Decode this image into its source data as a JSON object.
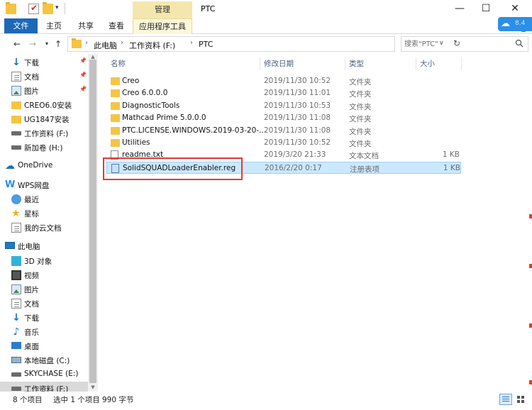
{
  "window": {
    "title": "PTC",
    "manage_tab": "管理",
    "minimize": "—",
    "maximize": "☐",
    "close": "✕"
  },
  "ribbon": {
    "tabs": [
      "文件",
      "主页",
      "共享",
      "查看",
      "应用程序工具"
    ],
    "help": "?"
  },
  "baidu": {
    "text": "8.4"
  },
  "address": {
    "crumbs": [
      "此电脑",
      "工作资料 (F:)",
      "PTC"
    ],
    "search_placeholder": "搜索\"PTC\""
  },
  "nav": {
    "items": [
      {
        "label": "下载",
        "icon": "download-icon",
        "pinned": true
      },
      {
        "label": "文档",
        "icon": "document-icon",
        "pinned": true
      },
      {
        "label": "图片",
        "icon": "picture-icon",
        "pinned": true
      },
      {
        "label": "CREO6.0安装",
        "icon": "folder-icon",
        "pinned": false
      },
      {
        "label": "UG1847安装",
        "icon": "folder-icon",
        "pinned": false
      },
      {
        "label": "工作资料 (F:)",
        "icon": "drive-icon",
        "pinned": false
      },
      {
        "label": "新加卷 (H:)",
        "icon": "drive-icon",
        "pinned": false
      },
      {
        "label": "OneDrive",
        "icon": "onedrive-icon",
        "pinned": false
      },
      {
        "label": "WPS网盘",
        "icon": "wps-icon",
        "pinned": false
      },
      {
        "label": "最近",
        "icon": "clock-icon",
        "pinned": false
      },
      {
        "label": "星标",
        "icon": "star-icon",
        "pinned": false
      },
      {
        "label": "我的云文档",
        "icon": "document-icon",
        "pinned": false
      },
      {
        "label": "此电脑",
        "icon": "computer-icon",
        "pinned": false
      },
      {
        "label": "3D 对象",
        "icon": "cube-icon",
        "pinned": false
      },
      {
        "label": "视频",
        "icon": "video-icon",
        "pinned": false
      },
      {
        "label": "图片",
        "icon": "picture-icon",
        "pinned": false
      },
      {
        "label": "文档",
        "icon": "document-icon",
        "pinned": false
      },
      {
        "label": "下载",
        "icon": "download-icon",
        "pinned": false
      },
      {
        "label": "音乐",
        "icon": "music-icon",
        "pinned": false
      },
      {
        "label": "桌面",
        "icon": "desktop-icon",
        "pinned": false
      },
      {
        "label": "本地磁盘 (C:)",
        "icon": "system-drive-icon",
        "pinned": false
      },
      {
        "label": "SKYCHASE (E:)",
        "icon": "drive-icon",
        "pinned": false
      },
      {
        "label": "工作资料 (F:)",
        "icon": "drive-icon",
        "pinned": false
      }
    ]
  },
  "columns": {
    "name": "名称",
    "date": "修改日期",
    "type": "类型",
    "size": "大小"
  },
  "files": [
    {
      "name": "Creo",
      "date": "2019/11/30 10:52",
      "type": "文件夹",
      "size": "",
      "kind": "folder"
    },
    {
      "name": "Creo 6.0.0.0",
      "date": "2019/11/30 11:01",
      "type": "文件夹",
      "size": "",
      "kind": "folder"
    },
    {
      "name": "DiagnosticTools",
      "date": "2019/11/30 10:53",
      "type": "文件夹",
      "size": "",
      "kind": "folder"
    },
    {
      "name": "Mathcad Prime 5.0.0.0",
      "date": "2019/11/30 11:08",
      "type": "文件夹",
      "size": "",
      "kind": "folder"
    },
    {
      "name": "PTC.LICENSE.WINDOWS.2019-03-20-...",
      "date": "2019/11/30 11:08",
      "type": "文件夹",
      "size": "",
      "kind": "folder"
    },
    {
      "name": "Utilities",
      "date": "2019/11/30 10:52",
      "type": "文件夹",
      "size": "",
      "kind": "folder"
    },
    {
      "name": "readme.txt",
      "date": "2019/3/20 21:33",
      "type": "文本文档",
      "size": "1 KB",
      "kind": "txt"
    },
    {
      "name": "SolidSQUADLoaderEnabler.reg",
      "date": "2016/2/20 0:17",
      "type": "注册表项",
      "size": "1 KB",
      "kind": "reg"
    }
  ],
  "status": {
    "count": "8 个项目",
    "selected": "选中 1 个项目",
    "size": "990 字节"
  }
}
